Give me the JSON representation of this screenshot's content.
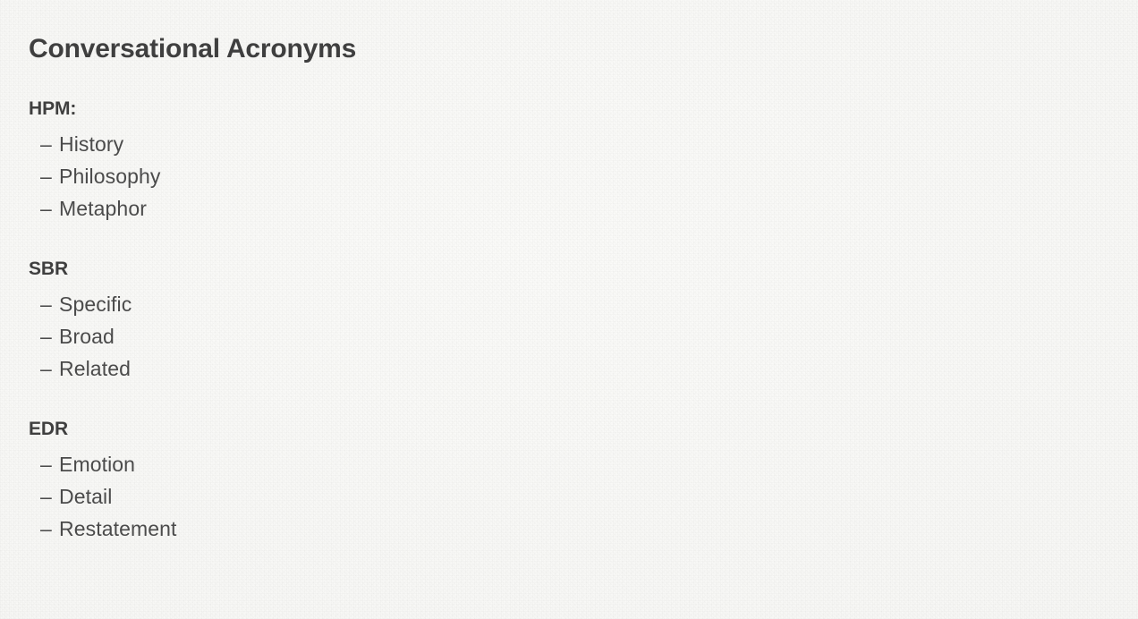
{
  "slide": {
    "title": "Conversational Acronyms",
    "background_color": "#f9f9f7",
    "title_color": "#3f3f3f",
    "body_text_color": "#4b4b4b",
    "bullet_glyph": "–",
    "sections": [
      {
        "label": "HPM:",
        "items": [
          "History",
          "Philosophy",
          "Metaphor"
        ]
      },
      {
        "label": "SBR",
        "items": [
          "Specific",
          "Broad",
          "Related"
        ]
      },
      {
        "label": "EDR",
        "items": [
          "Emotion",
          "Detail",
          "Restatement"
        ]
      }
    ]
  }
}
